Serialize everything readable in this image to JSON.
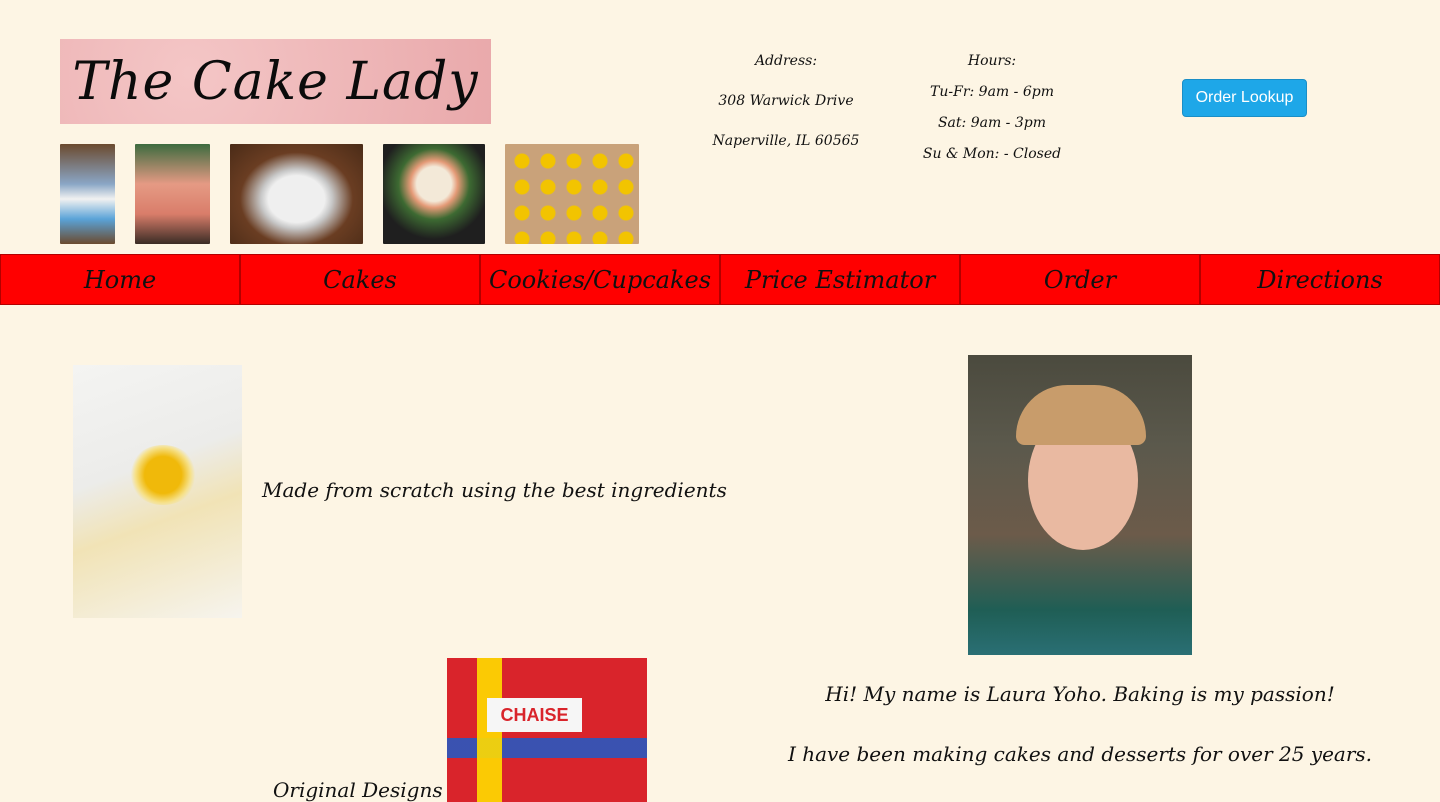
{
  "header": {
    "logo_text": "The Cake Lady",
    "order_lookup_label": "Order Lookup"
  },
  "address": {
    "label": "Address:",
    "line1": "308 Warwick Drive",
    "line2": "Naperville, IL 60565"
  },
  "hours": {
    "label": "Hours:",
    "tu_fr": "Tu-Fr: 9am - 6pm",
    "sat": "Sat: 9am - 3pm",
    "su_mon": "Su & Mon: - Closed"
  },
  "nav": {
    "items": [
      {
        "label": "Home"
      },
      {
        "label": "Cakes"
      },
      {
        "label": "Cookies/Cupcakes"
      },
      {
        "label": "Price Estimator"
      },
      {
        "label": "Order"
      },
      {
        "label": "Directions"
      }
    ]
  },
  "main": {
    "caption_ingredients": "Made from scratch using the best ingredients",
    "caption_designs": "Original Designs",
    "lego_label": "CHAISE",
    "intro_line1": "Hi! My name is Laura Yoho. Baking is my passion!",
    "intro_line2": "I have been making cakes and desserts for over 25 years."
  },
  "colors": {
    "background": "#fdf5e4",
    "nav_bg": "#ff0000",
    "button_bg": "#1ea7e8"
  }
}
